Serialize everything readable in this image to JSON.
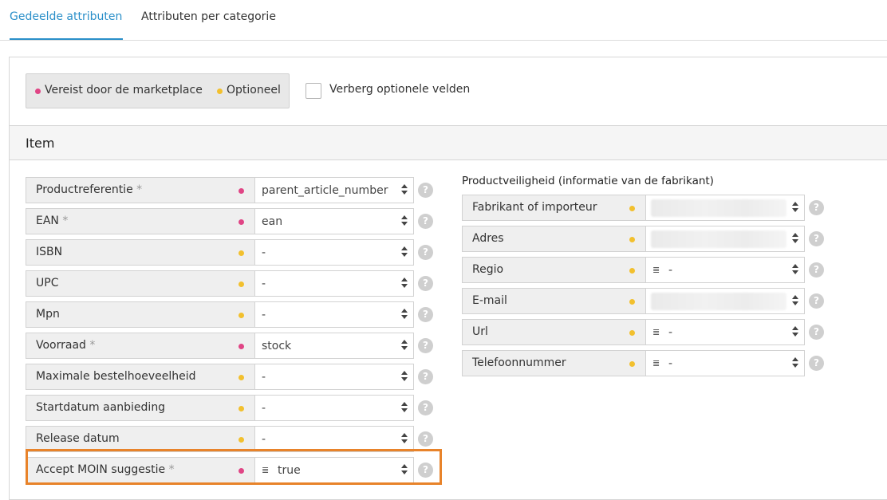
{
  "tabs": [
    {
      "label": "Gedeelde attributen",
      "active": true
    },
    {
      "label": "Attributen per categorie",
      "active": false
    }
  ],
  "legend": {
    "required_label": "Vereist door de marketplace",
    "optional_label": "Optioneel",
    "required_color": "#e04585",
    "optional_color": "#f2c02e"
  },
  "hide_optional": {
    "label": "Verberg optionele velden",
    "checked": false
  },
  "section": {
    "title": "Item"
  },
  "left_fields": [
    {
      "label": "Productreferentie",
      "required": true,
      "value": "parent_article_number"
    },
    {
      "label": "EAN",
      "required": true,
      "value": "ean"
    },
    {
      "label": "ISBN",
      "required": false,
      "value": "-"
    },
    {
      "label": "UPC",
      "required": false,
      "value": "-"
    },
    {
      "label": "Mpn",
      "required": false,
      "value": "-"
    },
    {
      "label": "Voorraad",
      "required": true,
      "value": "stock"
    },
    {
      "label": "Maximale bestelhoeveelheid",
      "required": false,
      "value": "-"
    },
    {
      "label": "Startdatum aanbieding",
      "required": false,
      "value": "-"
    },
    {
      "label": "Release datum",
      "required": false,
      "value": "-"
    },
    {
      "label": "Accept MOIN suggestie",
      "required": true,
      "value": "true",
      "list_icon": true
    }
  ],
  "right_group": {
    "title": "Productveiligheid (informatie van de fabrikant)",
    "fields": [
      {
        "label": "Fabrikant of importeur",
        "required": false,
        "value": "",
        "blurred": true
      },
      {
        "label": "Adres",
        "required": false,
        "value": "",
        "blurred": true
      },
      {
        "label": "Regio",
        "required": false,
        "value": "-",
        "list_icon": true
      },
      {
        "label": "E-mail",
        "required": false,
        "value": "",
        "blurred": true
      },
      {
        "label": "Url",
        "required": false,
        "value": "-",
        "list_icon": true
      },
      {
        "label": "Telefoonnummer",
        "required": false,
        "value": "-",
        "list_icon": true
      }
    ]
  },
  "required_marker": "*",
  "help_symbol": "?",
  "list_icon_glyph": "≣"
}
